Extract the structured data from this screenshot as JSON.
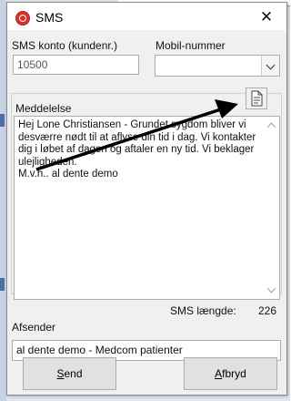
{
  "window": {
    "title": "SMS",
    "close_glyph": "✕"
  },
  "account": {
    "label": "SMS konto (kundenr.)",
    "value": "10500"
  },
  "mobile": {
    "label": "Mobil-nummer",
    "value": ""
  },
  "message": {
    "label": "Meddelelse",
    "text": "Hej Lone Christiansen - Grundet sygdom bliver vi desværre nødt til at aflyse din tid i dag. Vi kontakter dig i løbet af dagen og aftaler en ny tid. Vi beklager ulejligheden.\nM.v.h.. al dente demo",
    "length_label": "SMS længde:",
    "length_value": "226",
    "template_button_icon": "document-icon"
  },
  "sender": {
    "label": "Afsender",
    "value": "al dente demo - Medcom patienter"
  },
  "buttons": {
    "send_mnemonic": "S",
    "send_rest": "end",
    "cancel_mnemonic": "A",
    "cancel_rest": "fbryd"
  },
  "colors": {
    "dialog_bg": "#f0f0f0",
    "icon_red": "#d8332a",
    "arrow": "#000000"
  }
}
